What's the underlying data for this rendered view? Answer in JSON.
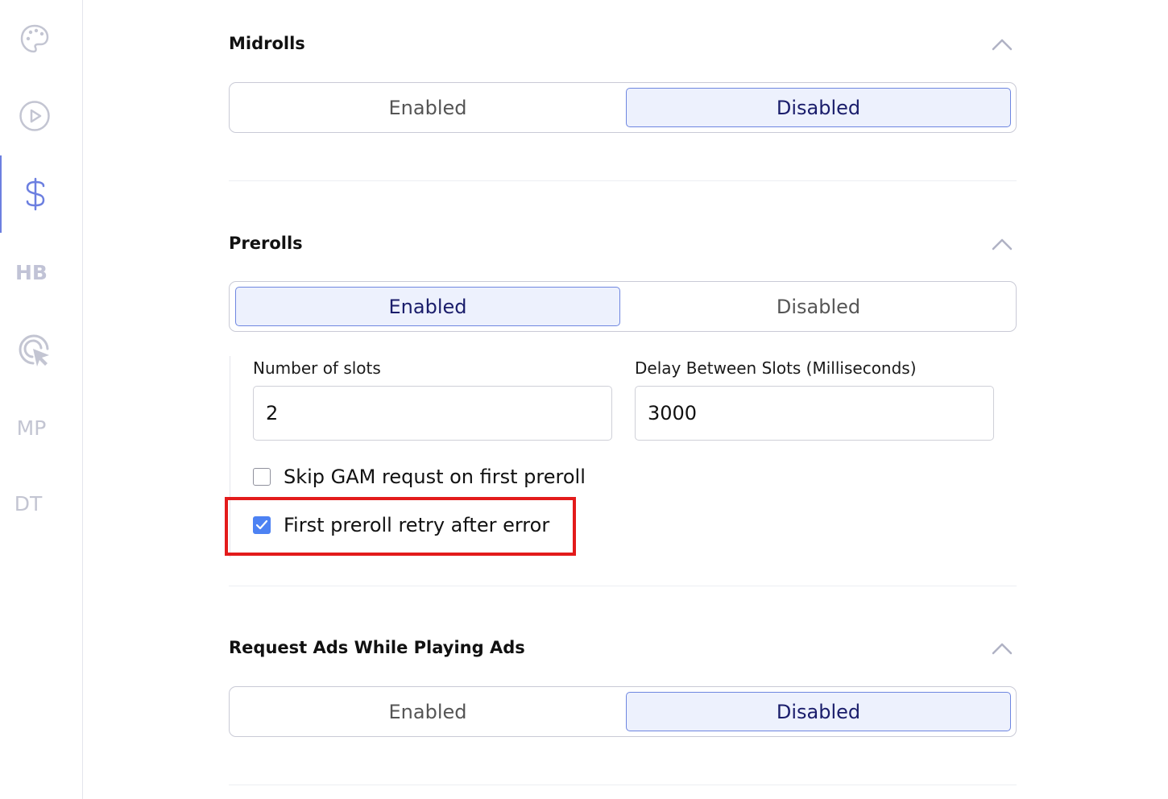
{
  "sidebar": {
    "items": [
      {
        "name": "palette-icon",
        "active": false
      },
      {
        "name": "play-circle-icon",
        "active": false
      },
      {
        "name": "dollar-icon",
        "active": true
      },
      {
        "name": "hb-icon",
        "label": "HB",
        "active": false
      },
      {
        "name": "cursor-target-icon",
        "active": false
      },
      {
        "name": "mp-icon",
        "label": "MP",
        "active": false
      },
      {
        "name": "dt-icon",
        "label": "DT",
        "active": false
      }
    ]
  },
  "midrolls": {
    "title": "Midrolls",
    "enabled_label": "Enabled",
    "disabled_label": "Disabled",
    "selected": "Disabled"
  },
  "prerolls": {
    "title": "Prerolls",
    "enabled_label": "Enabled",
    "disabled_label": "Disabled",
    "selected": "Enabled",
    "slots_label": "Number of slots",
    "slots_value": "2",
    "delay_label": "Delay Between Slots (Milliseconds)",
    "delay_value": "3000",
    "skip_gam_label": "Skip GAM requst on first preroll",
    "skip_gam_checked": false,
    "retry_label": "First preroll retry after error",
    "retry_checked": true
  },
  "request_ads": {
    "title": "Request Ads While Playing Ads",
    "enabled_label": "Enabled",
    "disabled_label": "Disabled",
    "selected": "Disabled"
  },
  "colors": {
    "accent": "#6e86e0",
    "selected_bg": "#edf1fd",
    "checkbox_checked": "#4d82f3",
    "highlight": "#e31b1b"
  }
}
